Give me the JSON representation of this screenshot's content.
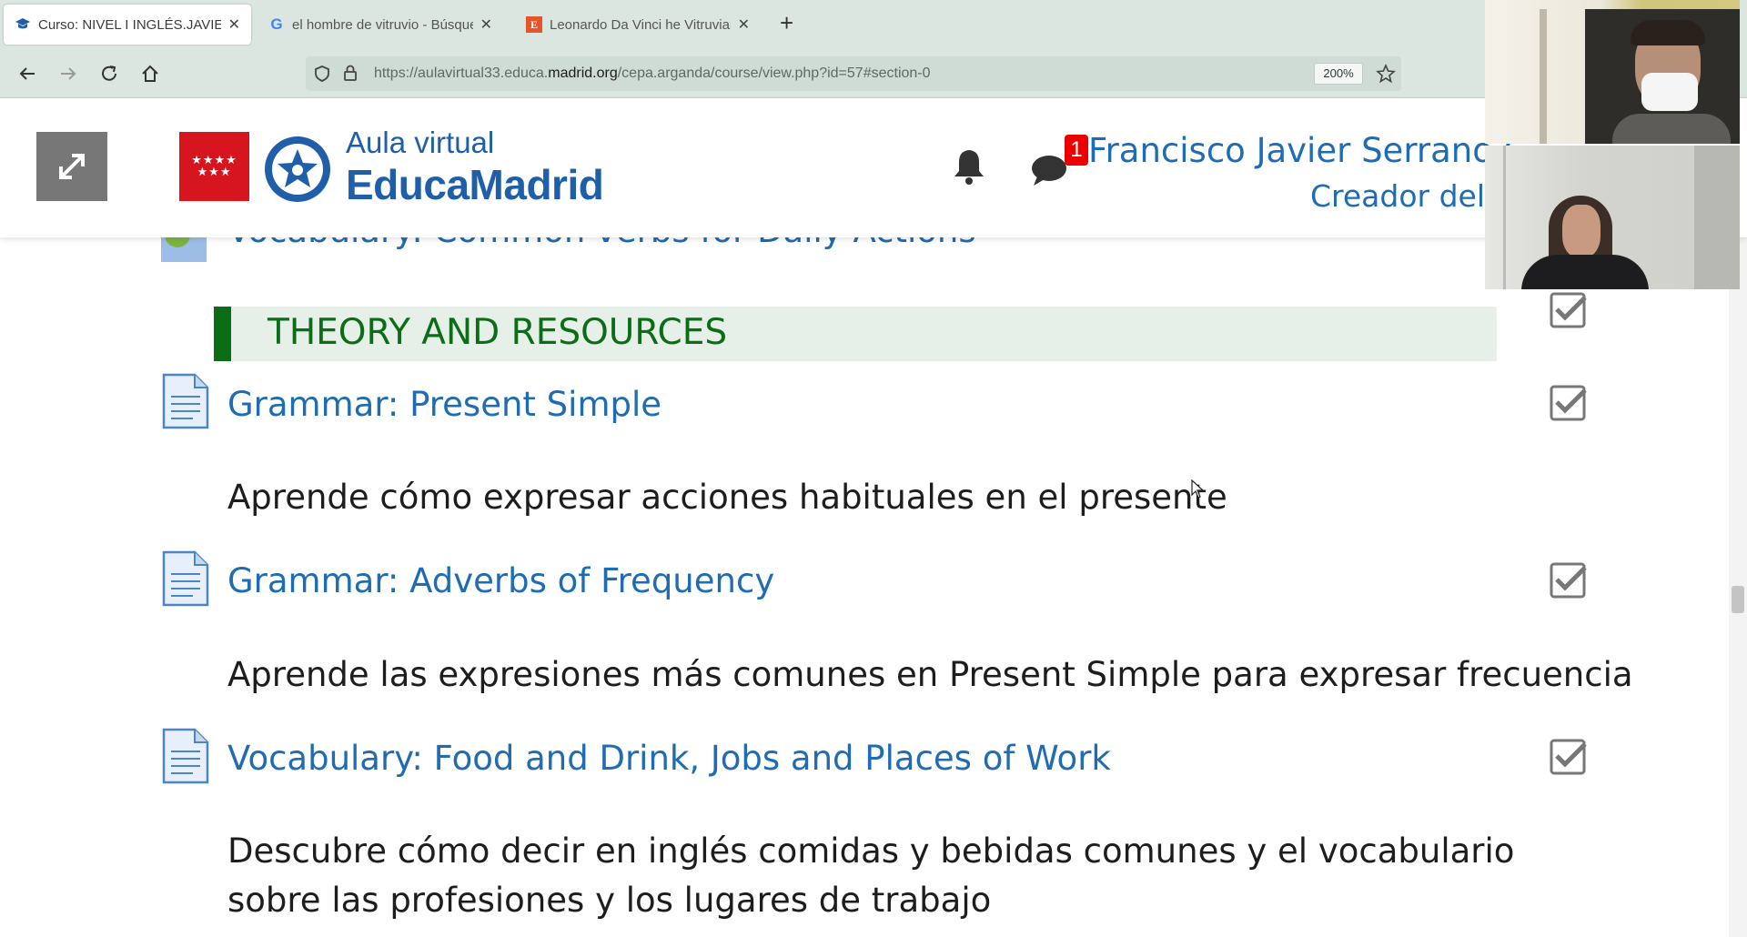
{
  "browser": {
    "tabs": [
      {
        "title": "Curso: NIVEL I INGLÉS.JAVIER",
        "favicon": "graduation-cap-icon",
        "active": true
      },
      {
        "title": "el hombre de vitruvio - Búsqueda",
        "favicon": "google-icon",
        "active": false
      },
      {
        "title": "Leonardo Da Vinci he Vitruvian",
        "favicon": "e-icon",
        "active": false
      }
    ],
    "url_prefix": "https://aulavirtual33.educa.",
    "url_domain": "madrid.org",
    "url_path": "/cepa.arganda/course/view.php?id=57#section-0",
    "zoom": "200%"
  },
  "header": {
    "brand_top": "Aula virtual",
    "brand_main": "EducaMadrid",
    "flag_stars": "★★★★ ★★★",
    "notification_count": "1",
    "user_name": "Francisco Javier Serrano G",
    "user_role": "Creador del c"
  },
  "content": {
    "previous_item": "Vocabulary: Common verbs for Daily Actions",
    "section_title": "THEORY AND RESOURCES",
    "activities": [
      {
        "title": "Grammar: Present Simple",
        "description": "Aprende cómo expresar acciones habituales en el presente"
      },
      {
        "title": "Grammar: Adverbs of Frequency",
        "description": "Aprende las expresiones más comunes en Present Simple para expresar frecuencia"
      },
      {
        "title": "Vocabulary: Food and Drink, Jobs and Places of Work",
        "description": " Descubre cómo decir en inglés comidas y bebidas comunes y el vocabulario sobre las profesiones y los lugares de trabajo"
      }
    ]
  },
  "colors": {
    "link": "#1f6cb3",
    "section_green": "#0b6e16",
    "brand_blue": "#1f5fa9",
    "flag_red": "#d7151e"
  }
}
